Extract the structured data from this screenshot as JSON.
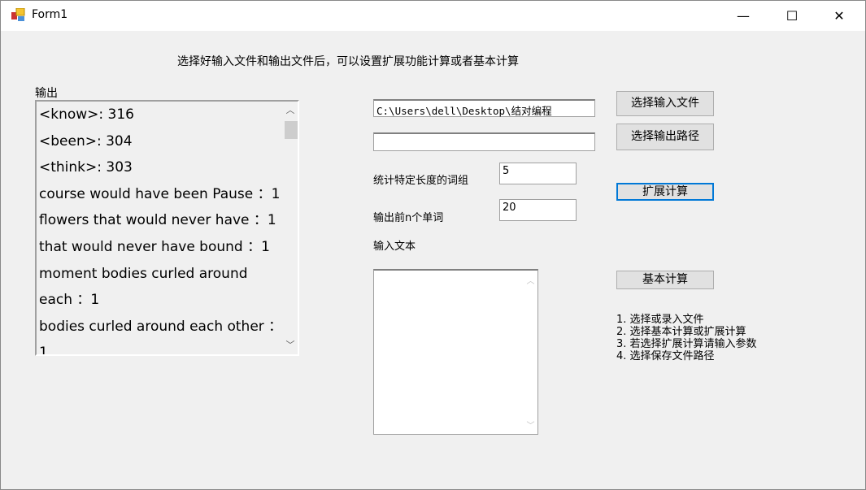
{
  "window": {
    "title": "Form1",
    "minimize": "—",
    "maximize": "☐",
    "close": "✕"
  },
  "instruction": "选择好输入文件和输出文件后，可以设置扩展功能计算或者基本计算",
  "output": {
    "label": "输出",
    "items": [
      "<know>: 316",
      "<been>: 304",
      "<think>: 303",
      "course would have been Pause ：1",
      "flowers that would never have ：1",
      "that would never have bound ：1",
      "moment bodies curled around",
      "each ：1",
      "bodies curled around each other ：",
      "1"
    ]
  },
  "input_path": "C:\\Users\\dell\\Desktop\\结对编程",
  "output_path": "",
  "buttons": {
    "select_input": "选择输入文件",
    "select_output": "选择输出路径",
    "extended": "扩展计算",
    "basic": "基本计算"
  },
  "phrase_length": {
    "label": "统计特定长度的词组",
    "value": "5"
  },
  "top_n": {
    "label": "输出前n个单词",
    "value": "20"
  },
  "input_text": {
    "label": "输入文本",
    "value": ""
  },
  "steps": [
    "1. 选择或录入文件",
    "2. 选择基本计算或扩展计算",
    "3. 若选择扩展计算请输入参数",
    "4. 选择保存文件路径"
  ]
}
